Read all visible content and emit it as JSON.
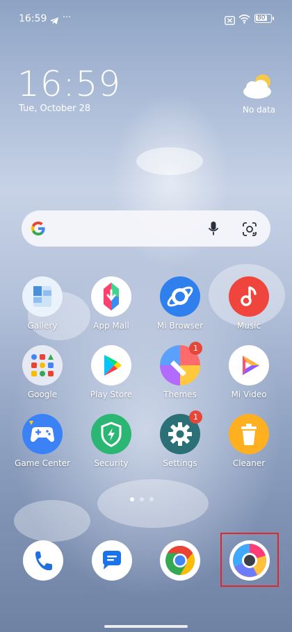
{
  "status_bar": {
    "time": "16:59",
    "battery": "80"
  },
  "clock_widget": {
    "time": "16:59",
    "date": "Tue, October 28"
  },
  "weather_widget": {
    "text": "No data"
  },
  "apps": [
    {
      "label": "Gallery"
    },
    {
      "label": "App Mall"
    },
    {
      "label": "Mi Browser"
    },
    {
      "label": "Music"
    },
    {
      "label": "Google"
    },
    {
      "label": "Play Store"
    },
    {
      "label": "Themes",
      "badge": "1"
    },
    {
      "label": "Mi Video"
    },
    {
      "label": "Game Center"
    },
    {
      "label": "Security"
    },
    {
      "label": "Settings",
      "badge": "1"
    },
    {
      "label": "Cleaner"
    }
  ],
  "dock": [
    "phone-icon",
    "messages-icon",
    "chrome-icon",
    "chrome-dev-icon"
  ],
  "colors": {
    "highlight": "#e0262a",
    "badge": "#e5483b"
  }
}
